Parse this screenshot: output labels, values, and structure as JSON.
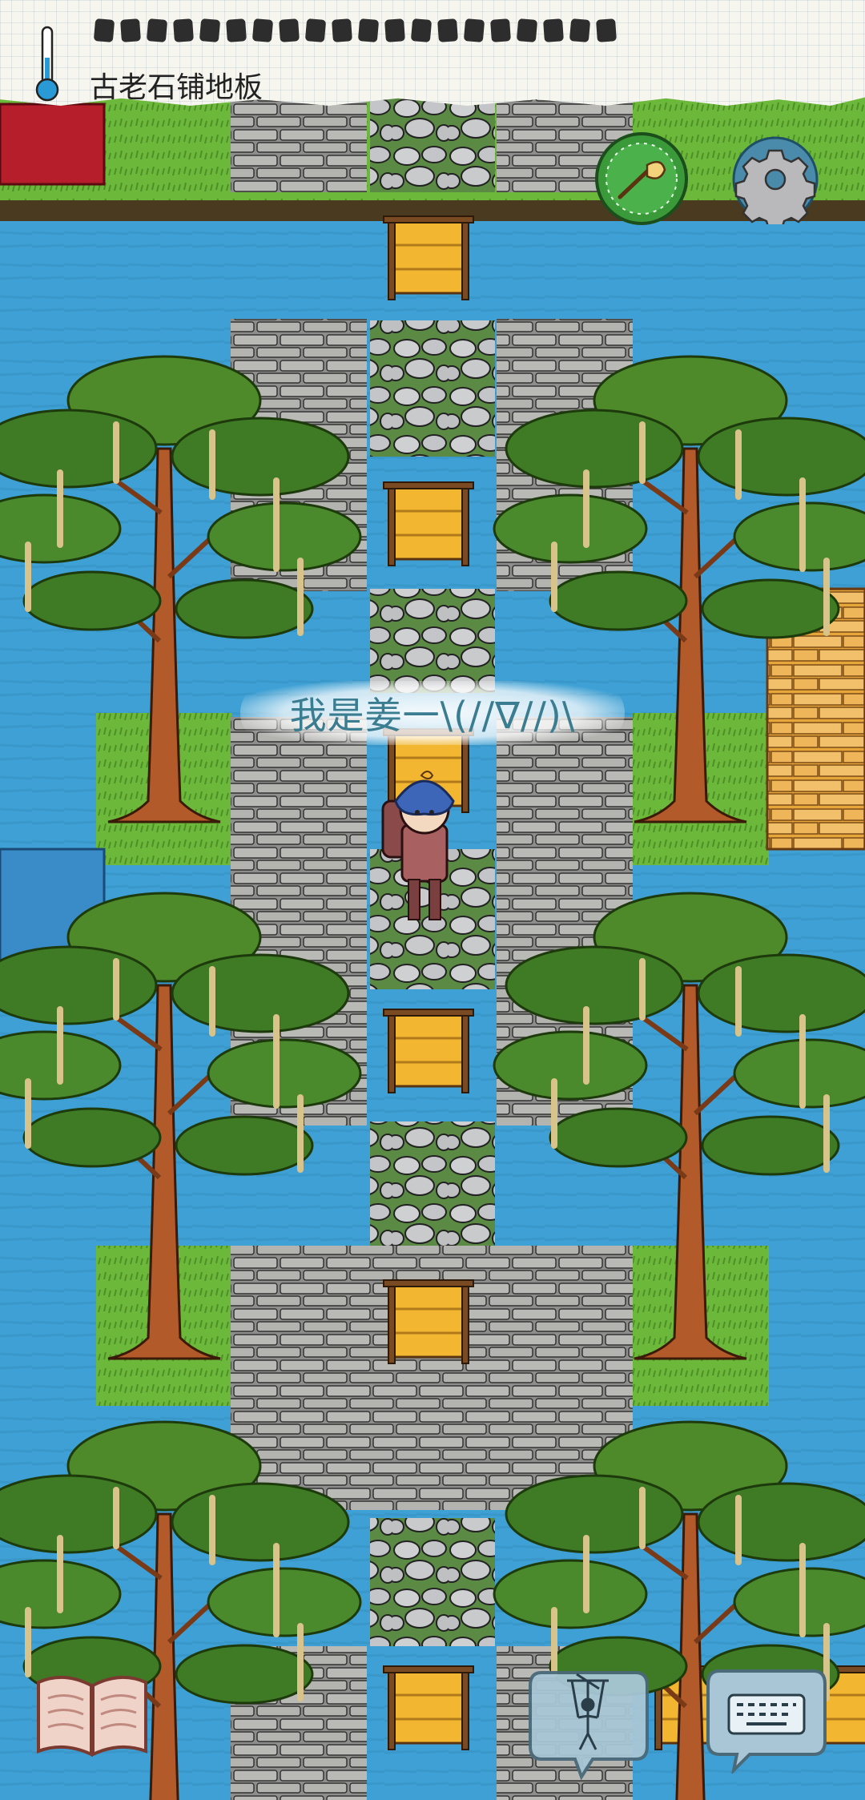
{
  "hud": {
    "item_label": "古老石铺地板",
    "thermometer_icon": "thermometer-icon",
    "compass_icon": "compass-icon",
    "settings_icon": "gear-icon"
  },
  "player": {
    "speech": "我是姜一\\(//∇//)\\"
  },
  "controls": {
    "journal_icon": "open-book-icon",
    "puppet_icon": "puppet-icon",
    "keyboard_icon": "keyboard-icon"
  },
  "colors": {
    "water": "#3ea0d4",
    "grass": "#6cb83a",
    "stone": "#a9a9a6",
    "plank": "#f2b630",
    "accent_green": "#3a9a3a"
  }
}
